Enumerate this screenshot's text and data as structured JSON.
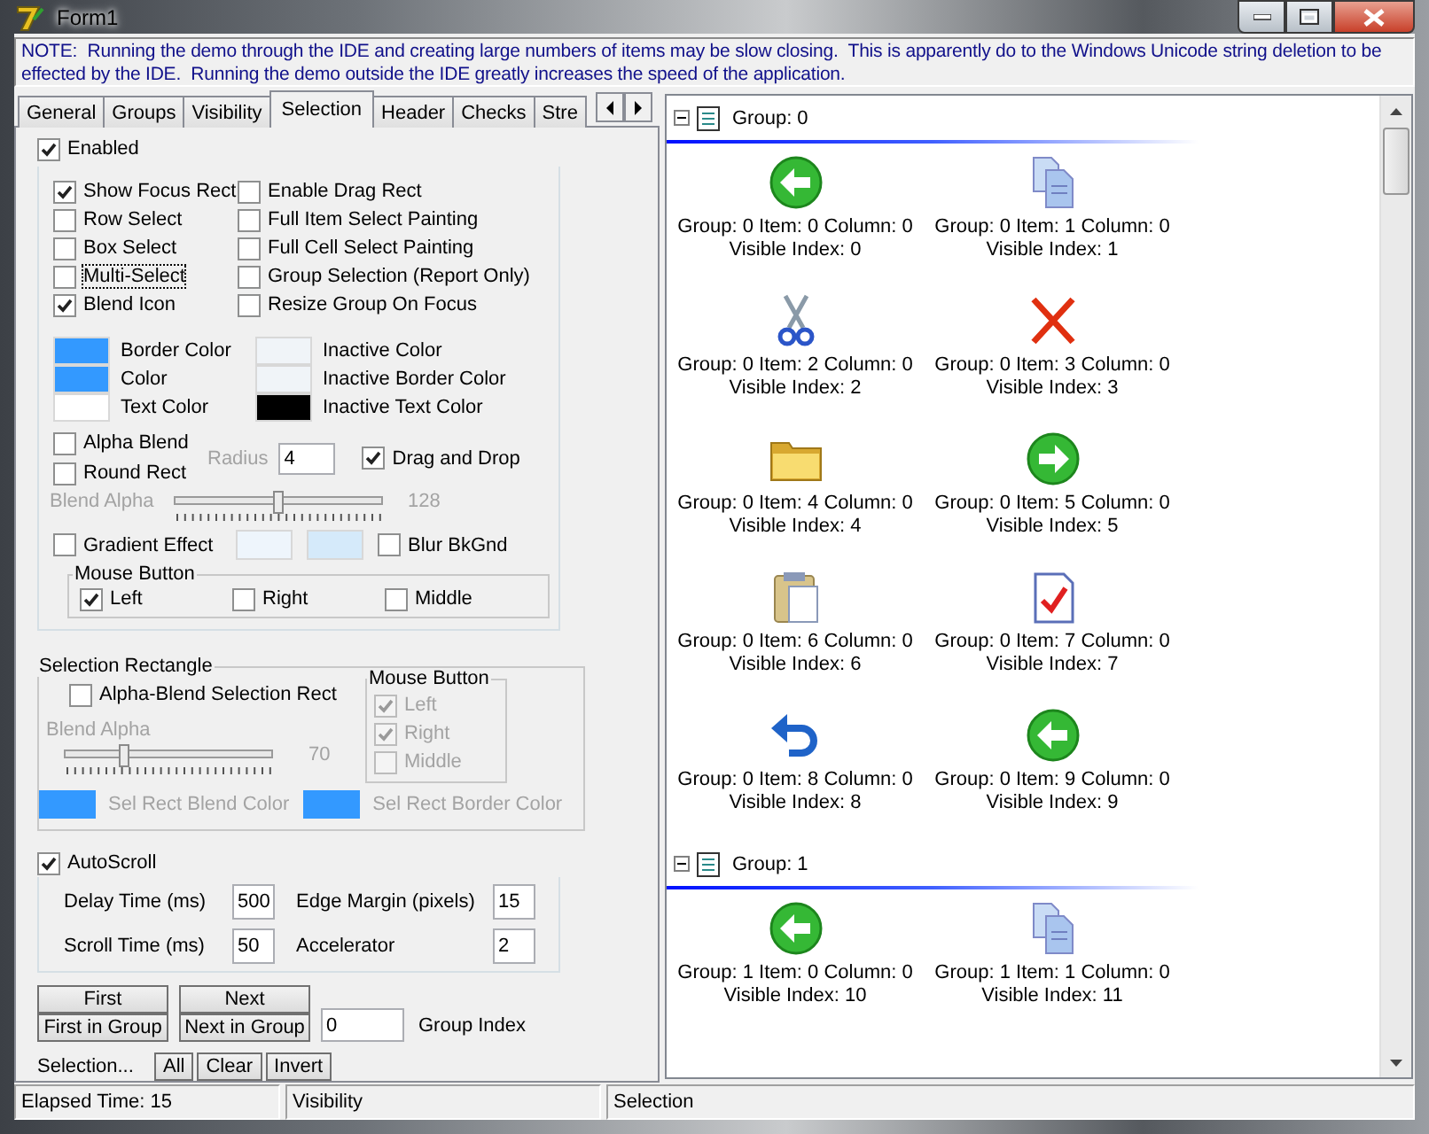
{
  "window": {
    "title": "Form1"
  },
  "note": "NOTE:  Running the demo through the IDE and creating large numbers of items may be slow closing.  This is apparently do to the Windows Unicode string deletion to be effected by the IDE.  Running the demo outside the IDE greatly increases the speed of the application.",
  "tabs": [
    {
      "label": "General",
      "selected": false
    },
    {
      "label": "Groups",
      "selected": false
    },
    {
      "label": "Visibility",
      "selected": false
    },
    {
      "label": "Selection",
      "selected": true
    },
    {
      "label": "Header",
      "selected": false
    },
    {
      "label": "Checks",
      "selected": false
    },
    {
      "label": "Stre",
      "selected": false
    }
  ],
  "selection_page": {
    "enabled": {
      "label": "Enabled",
      "checked": true
    },
    "options_left": [
      {
        "label": "Show Focus Rect",
        "checked": true,
        "focused": false
      },
      {
        "label": "Row Select",
        "checked": false,
        "focused": false
      },
      {
        "label": "Box Select",
        "checked": false,
        "focused": false
      },
      {
        "label": "Multi-Select",
        "checked": false,
        "focused": true
      },
      {
        "label": "Blend Icon",
        "checked": true,
        "focused": false
      }
    ],
    "options_right": [
      {
        "label": "Enable Drag Rect",
        "checked": false,
        "focused": false
      },
      {
        "label": "Full Item Select Painting",
        "checked": false,
        "focused": false
      },
      {
        "label": "Full Cell Select Painting",
        "checked": false,
        "focused": false
      },
      {
        "label": "Group Selection (Report Only)",
        "checked": false,
        "focused": false
      },
      {
        "label": "Resize Group On Focus",
        "checked": false,
        "focused": false
      }
    ],
    "colors_left": [
      {
        "label": "Border Color",
        "color": "#3399ff"
      },
      {
        "label": "Color",
        "color": "#3399ff"
      },
      {
        "label": "Text Color",
        "color": "#ffffff"
      }
    ],
    "colors_right": [
      {
        "label": "Inactive Color",
        "color": "#f0f4f8"
      },
      {
        "label": "Inactive Border Color",
        "color": "#f0f4f8"
      },
      {
        "label": "Inactive Text Color",
        "color": "#000000"
      }
    ],
    "alpha_blend": {
      "label": "Alpha Blend",
      "checked": false
    },
    "round_rect": {
      "label": "Round Rect",
      "checked": false
    },
    "radius": {
      "label": "Radius",
      "value": "4",
      "disabled": true
    },
    "drag_and_drop": {
      "label": "Drag and Drop",
      "checked": true
    },
    "blend_alpha": {
      "label": "Blend Alpha",
      "level": 0.5,
      "reading": "128",
      "disabled": true
    },
    "gradient_effect": {
      "label": "Gradient Effect",
      "checked": false
    },
    "gradient_swatches": [
      {
        "color": "#eef5fc"
      },
      {
        "color": "#d5eafa"
      }
    ],
    "blur_bkgnd": {
      "label": "Blur BkGnd",
      "checked": false
    },
    "mouse_button": {
      "title": "Mouse Button",
      "buttons": [
        {
          "label": "Left",
          "checked": true
        },
        {
          "label": "Right",
          "checked": false
        },
        {
          "label": "Middle",
          "checked": false
        }
      ]
    }
  },
  "selection_rectangle": {
    "title": "Selection Rectangle",
    "alpha_blend": {
      "label": "Alpha-Blend Selection Rect",
      "checked": false
    },
    "blend_alpha": {
      "label": "Blend Alpha",
      "level": 0.28,
      "reading": "70",
      "disabled": true
    },
    "swatches": [
      {
        "label": "Sel Rect Blend Color",
        "color": "#3399ff",
        "disabled": true
      },
      {
        "label": "Sel Rect Border Color",
        "color": "#3399ff",
        "disabled": true
      }
    ],
    "mouse_button": {
      "title": "Mouse Button",
      "buttons": [
        {
          "label": "Left",
          "checked": true,
          "disabled": true
        },
        {
          "label": "Right",
          "checked": true,
          "disabled": true
        },
        {
          "label": "Middle",
          "checked": false,
          "disabled": true
        }
      ]
    }
  },
  "autoscroll": {
    "label": "AutoScroll",
    "checked": true,
    "fields": [
      {
        "label": "Delay Time (ms)",
        "value": "500"
      },
      {
        "label": "Edge Margin (pixels)",
        "value": "15"
      },
      {
        "label": "Scroll Time (ms)",
        "value": "50"
      },
      {
        "label": "Accelerator",
        "value": "2"
      }
    ]
  },
  "navigation": {
    "buttons": [
      "First",
      "First in Group",
      "Next",
      "Next in Group"
    ],
    "group_index": {
      "label": "Group Index",
      "value": "0"
    }
  },
  "selection_actions": {
    "label": "Selection...",
    "buttons": [
      "All",
      "Clear",
      "Invert"
    ]
  },
  "list_view": {
    "groups": [
      {
        "title": "Group: 0",
        "expanded": true,
        "items": [
          {
            "kind": "back",
            "line1": "Group: 0 Item: 0 Column: 0",
            "line2": "Visible Index: 0"
          },
          {
            "kind": "copy",
            "line1": "Group: 0 Item: 1 Column: 0",
            "line2": "Visible Index: 1"
          },
          {
            "kind": "cut",
            "line1": "Group: 0 Item: 2 Column: 0",
            "line2": "Visible Index: 2"
          },
          {
            "kind": "delete",
            "line1": "Group: 0 Item: 3 Column: 0",
            "line2": "Visible Index: 3"
          },
          {
            "kind": "folder",
            "line1": "Group: 0 Item: 4 Column: 0",
            "line2": "Visible Index: 4"
          },
          {
            "kind": "forward",
            "line1": "Group: 0 Item: 5 Column: 0",
            "line2": "Visible Index: 5"
          },
          {
            "kind": "paste",
            "line1": "Group: 0 Item: 6 Column: 0",
            "line2": "Visible Index: 6"
          },
          {
            "kind": "check",
            "line1": "Group: 0 Item: 7 Column: 0",
            "line2": "Visible Index: 7"
          },
          {
            "kind": "undo",
            "line1": "Group: 0 Item: 8 Column: 0",
            "line2": "Visible Index: 8"
          },
          {
            "kind": "back",
            "line1": "Group: 0 Item: 9 Column: 0",
            "line2": "Visible Index: 9"
          }
        ]
      },
      {
        "title": "Group: 1",
        "expanded": true,
        "items": [
          {
            "kind": "back",
            "line1": "Group: 1 Item: 0 Column: 0",
            "line2": "Visible Index: 10"
          },
          {
            "kind": "copy",
            "line1": "Group: 1 Item: 1 Column: 0",
            "line2": "Visible Index: 11"
          }
        ]
      }
    ]
  },
  "status_bar": [
    "Elapsed Time: 15",
    "Visibility",
    "Selection"
  ]
}
